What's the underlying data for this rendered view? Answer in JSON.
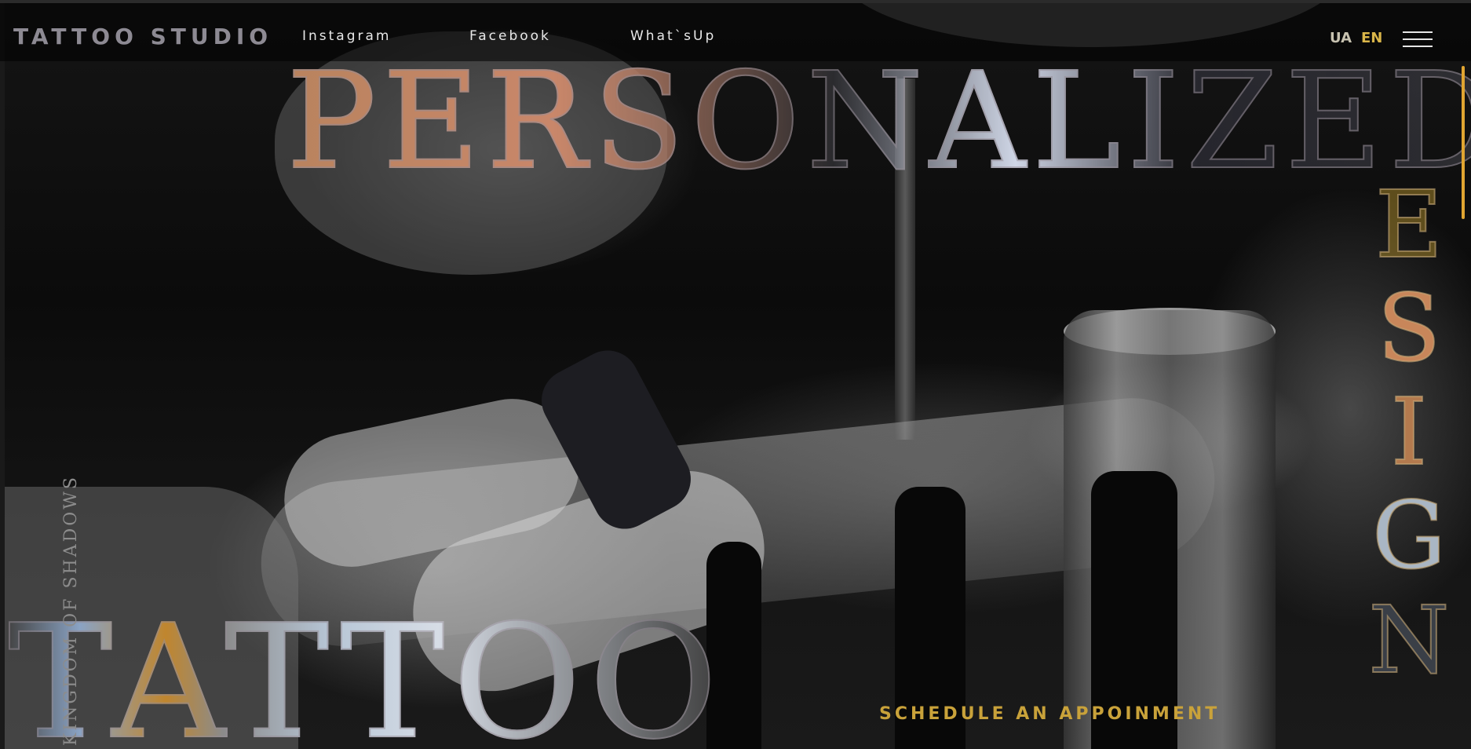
{
  "header": {
    "logo": "TATTOO STUDIO",
    "nav": [
      {
        "label": "Instagram"
      },
      {
        "label": "Facebook"
      },
      {
        "label": "What`sUp"
      }
    ],
    "languages": {
      "ua": "UA",
      "en": "EN",
      "active": "EN"
    },
    "menu_icon": "hamburger-menu-icon"
  },
  "hero": {
    "headline_top": "PERSONALIZED",
    "headline_vertical": [
      "E",
      "S",
      "I",
      "G",
      "N"
    ],
    "headline_bottom": "TATTOO",
    "side_caption": "KINGDOM OF SHADOWS",
    "cta": "SCHEDULE AN APPOINMENT"
  },
  "colors": {
    "accent": "#d9b549",
    "cta": "#c9a23a",
    "background": "#000000"
  }
}
